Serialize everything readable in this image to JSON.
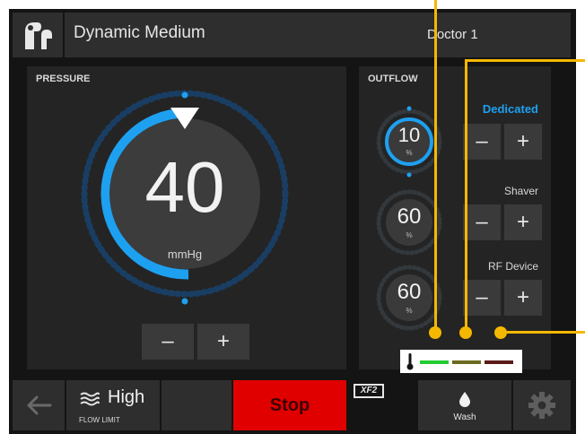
{
  "header": {
    "mode_title": "Dynamic Medium",
    "user": "Doctor 1"
  },
  "pressure": {
    "title": "PRESSURE",
    "value": "40",
    "unit": "mmHg",
    "minus": "–",
    "plus": "+"
  },
  "outflow": {
    "title": "OUTFLOW",
    "rows": [
      {
        "label": "Dedicated",
        "value": "10",
        "unit": "%",
        "minus": "–",
        "plus": "+",
        "active": true
      },
      {
        "label": "Shaver",
        "value": "60",
        "unit": "%",
        "minus": "–",
        "plus": "+",
        "active": false
      },
      {
        "label": "RF Device",
        "value": "60",
        "unit": "%",
        "minus": "–",
        "plus": "+",
        "active": false
      }
    ]
  },
  "bottom": {
    "flow_value": "High",
    "flow_label": "FLOW LIMIT",
    "stop_label": "Stop",
    "badge": "XF2",
    "wash_label": "Wash"
  },
  "colors": {
    "accent": "#1ea0f0",
    "stop": "#e00000",
    "callout": "#f5b800",
    "temp_green": "#22cc33",
    "temp_yellow": "#6b6b1f",
    "temp_red": "#5a1a1a"
  },
  "icons": [
    "logo-icon",
    "back-arrow-icon",
    "waves-icon",
    "drop-icon",
    "gear-icon",
    "thermometer-icon"
  ]
}
